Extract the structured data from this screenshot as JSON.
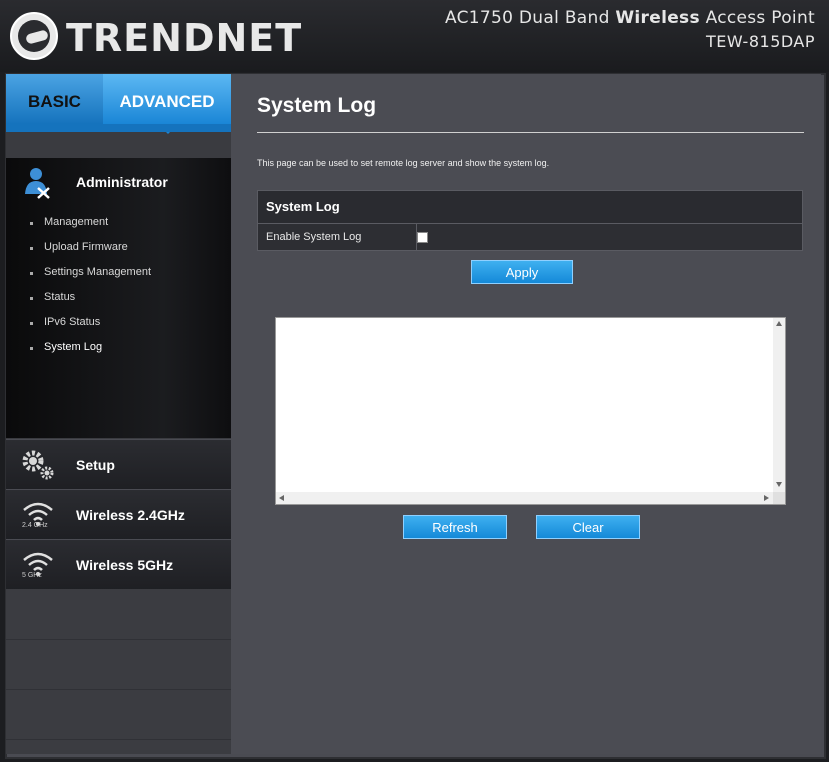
{
  "header": {
    "brand": "TRENDNET",
    "product_prefix": "AC1750 Dual Band ",
    "product_bold": "Wireless",
    "product_suffix": " Access Point",
    "model": "TEW-815DAP"
  },
  "tabs": {
    "basic": "BASIC",
    "advanced": "ADVANCED"
  },
  "sidebar": {
    "admin_title": "Administrator",
    "items": [
      {
        "label": "Management"
      },
      {
        "label": "Upload Firmware"
      },
      {
        "label": "Settings Management"
      },
      {
        "label": "Status"
      },
      {
        "label": "IPv6 Status"
      },
      {
        "label": "System Log"
      }
    ],
    "setup": "Setup",
    "wireless24": "Wireless 2.4GHz",
    "wireless24_freq": "2.4 GHz",
    "wireless5": "Wireless 5GHz",
    "wireless5_freq": "5 GHz"
  },
  "main": {
    "title": "System Log",
    "description": "This page can be used to set remote log server and show the system log.",
    "table_header": "System Log",
    "enable_label": "Enable System Log",
    "enable_checked": false,
    "apply": "Apply",
    "log_text": "",
    "refresh": "Refresh",
    "clear": "Clear"
  },
  "colors": {
    "accent": "#1a86d6",
    "button": "#1489d8",
    "panel_bg": "#4b4c53",
    "header_bg": "#1f2023"
  }
}
